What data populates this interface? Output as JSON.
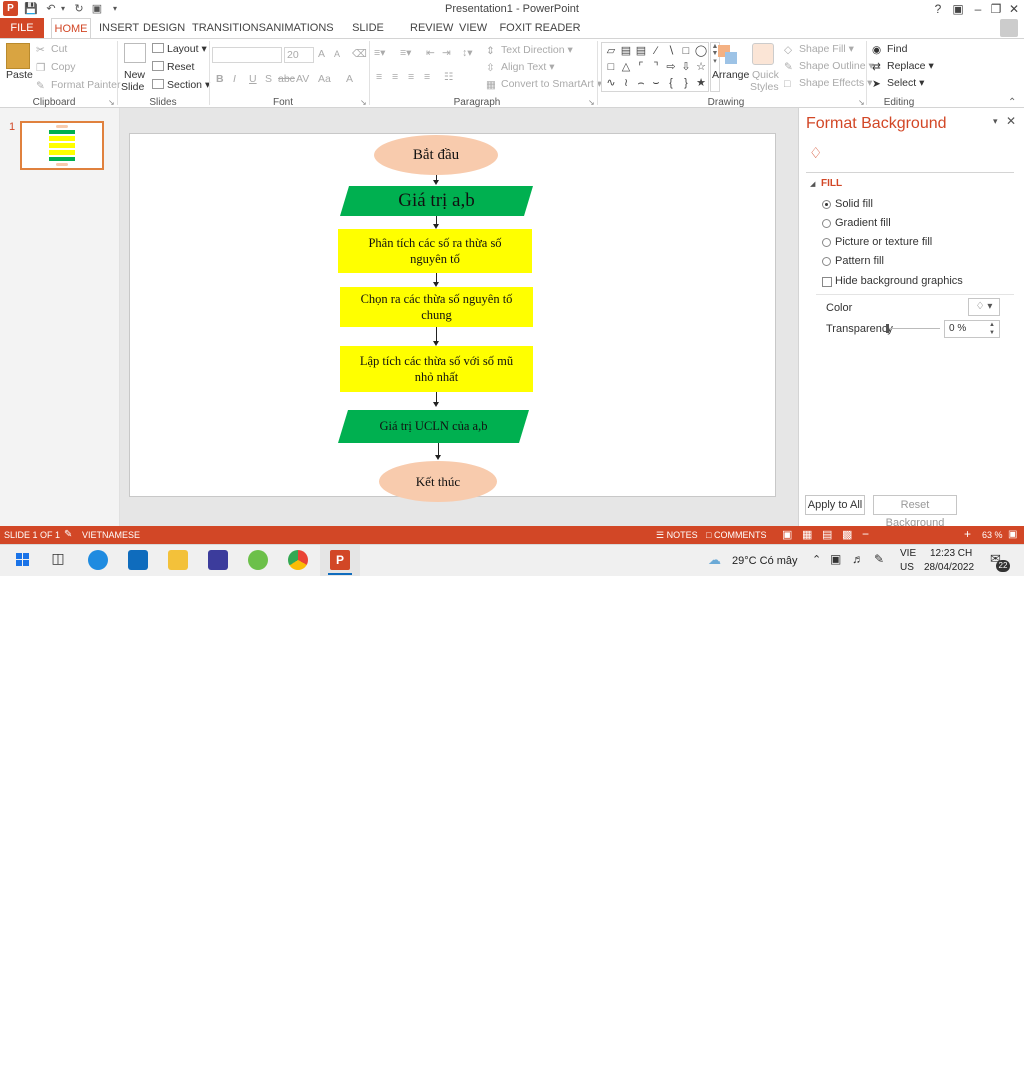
{
  "title_bar": {
    "window_title": "Presentation1 - PowerPoint",
    "app_logo": "P",
    "qat_icons": [
      "save-icon",
      "undo-icon",
      "redo-icon",
      "start-from-beginning-icon",
      "customize-qat-icon"
    ]
  },
  "ribbon_tabs": [
    "FILE",
    "HOME",
    "INSERT",
    "DESIGN",
    "TRANSITIONS",
    "ANIMATIONS",
    "SLIDE SHOW",
    "REVIEW",
    "VIEW",
    "FOXIT READER PDF"
  ],
  "ribbon": {
    "clipboard": {
      "paste": "Paste",
      "cut": "Cut",
      "copy": "Copy",
      "format_painter": "Format Painter",
      "label": "Clipboard"
    },
    "slides": {
      "new_slide_1": "New",
      "new_slide_2": "Slide",
      "layout": "Layout",
      "reset": "Reset",
      "section": "Section",
      "label": "Slides"
    },
    "font": {
      "font_size": "20",
      "label": "Font",
      "bold": "B",
      "italic": "I",
      "underline": "U",
      "shadow": "S",
      "strike": "abc",
      "spacing": "AV",
      "case": "Aa",
      "color": "A",
      "grow": "A",
      "shrink": "A"
    },
    "paragraph": {
      "text_direction": "Text Direction",
      "align_text": "Align Text",
      "smartart": "Convert to SmartArt",
      "label": "Paragraph"
    },
    "drawing": {
      "arrange": "Arrange",
      "quick_styles_1": "Quick",
      "quick_styles_2": "Styles",
      "shape_fill": "Shape Fill",
      "shape_outline": "Shape Outline",
      "shape_effects": "Shape Effects",
      "label": "Drawing"
    },
    "editing": {
      "find": "Find",
      "replace": "Replace",
      "select": "Select",
      "label": "Editing"
    }
  },
  "thumbnail": {
    "number": "1"
  },
  "flowchart": {
    "start": "Bắt đầu",
    "input": "Giá trị a,b",
    "step1": "Phân tích các số ra thừa số nguyên tố",
    "step2": "Chọn ra các thừa số nguyên tố chung",
    "step3": "Lập tích các thừa số với số mũ nhỏ nhất",
    "output": "Giá trị UCLN của a,b",
    "end": "Kết thúc",
    "colors": {
      "terminal": "#f8cbad",
      "io": "#00b050",
      "process": "#ffff00"
    }
  },
  "format_background": {
    "title": "Format Background",
    "section": "FILL",
    "options": [
      "Solid fill",
      "Gradient fill",
      "Picture or texture fill",
      "Pattern fill"
    ],
    "selected": "Solid fill",
    "hide_bg": "Hide background graphics",
    "color_label": "Color",
    "transparency_label": "Transparency",
    "transparency_value": "0 %",
    "apply_all": "Apply to All",
    "reset_bg": "Reset Background"
  },
  "status_bar": {
    "slide_info": "SLIDE 1 OF 1",
    "language": "VIETNAMESE",
    "notes": "NOTES",
    "comments": "COMMENTS",
    "zoom": "63 %",
    "zoom_level": 0.63
  },
  "taskbar": {
    "weather": "29°C  Có mây",
    "lang_1": "VIE",
    "lang_2": "US",
    "time": "12:23 CH",
    "date": "28/04/2022",
    "notification_count": "22",
    "apps": [
      "windows-start-icon",
      "task-view-icon",
      "edge-icon",
      "mail-icon",
      "file-explorer-icon",
      "app-icon",
      "app-icon-2",
      "chrome-icon",
      "powerpoint-icon"
    ]
  },
  "accent_color": "#d24726"
}
